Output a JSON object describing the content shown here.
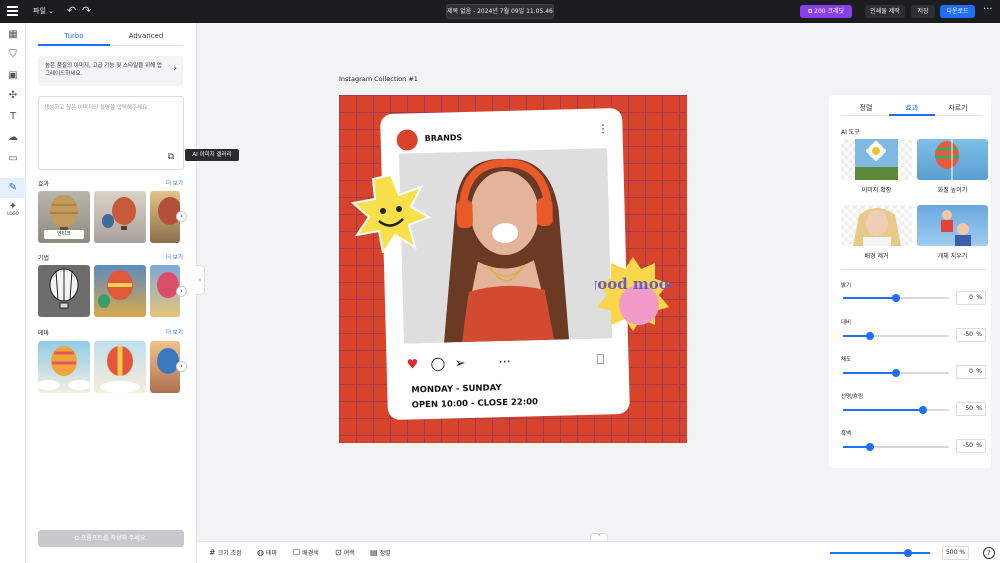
{
  "topbar": {
    "file_menu": "파일",
    "doc_title": "제목 없음 - 2024년 7월 09일 11.05.46",
    "credit_button": "200 크레딧",
    "print_button": "인쇄물 제작",
    "save_button": "저장",
    "download_button": "다운로드",
    "more": "···"
  },
  "rail": {
    "logo_label": "LOGO"
  },
  "left_panel": {
    "tabs": [
      "Turbo",
      "Advanced"
    ],
    "upgrade_text": "높은 품질의 이미지, 고급 기능 및 스타일을 위해 업그레이드하세요.",
    "prompt_placeholder": "생성하고 싶은 이미지의 설명을 입력해주세요.",
    "gallery_tooltip": "AI 이미지 갤러리",
    "sections": [
      {
        "title": "효과",
        "more": "더 보기",
        "first_tag": "엔티크"
      },
      {
        "title": "기법",
        "more": "더 보기"
      },
      {
        "title": "테마",
        "more": "더 보기"
      }
    ],
    "generate_button": "프롬프트를 작성해 주세요."
  },
  "canvas": {
    "label": "Instagram Collection #1",
    "brand": "BRANDS",
    "sticker_text": "good mood",
    "line1": "MONDAY - SUNDAY",
    "line2": "OPEN 10:00 - CLOSE 22:00"
  },
  "right_panel": {
    "tabs": [
      "정렬",
      "효과",
      "자르기"
    ],
    "active_tab": "효과",
    "ai_title": "AI 도구",
    "tools": [
      "이미지 확장",
      "화질 높이기",
      "배경 제거",
      "개체 지우기"
    ],
    "adjustments": [
      {
        "label": "밝기",
        "value": "0",
        "unit": "%",
        "level": 0.5
      },
      {
        "label": "대비",
        "value": "-50",
        "unit": "%",
        "level": 0.25
      },
      {
        "label": "채도",
        "value": "0",
        "unit": "%",
        "level": 0.5
      },
      {
        "label": "선명/흐림",
        "value": "50",
        "unit": "%",
        "level": 0.75
      },
      {
        "label": "흑백",
        "value": "-50",
        "unit": "%",
        "level": 0.25
      }
    ]
  },
  "bottombar": {
    "resize": "크기 조정",
    "theme": "테마",
    "background": "배경색",
    "margin": "여백",
    "align": "정렬",
    "zoom": "500",
    "zoom_unit": "%",
    "help": "?"
  },
  "colors": {
    "accent": "#1e6ff5",
    "credit": "#8a3ee8",
    "artboard": "#d8432c"
  }
}
